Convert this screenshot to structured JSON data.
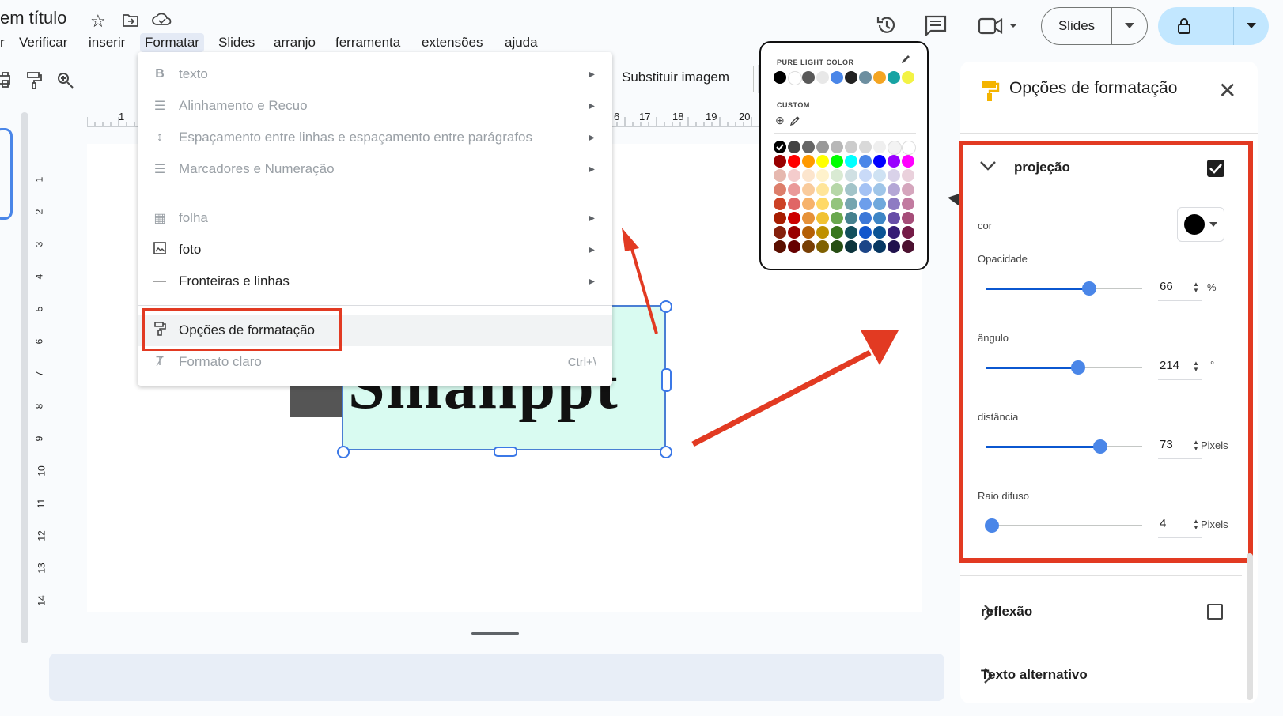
{
  "doc": {
    "title": "em título"
  },
  "menu": [
    "r",
    "Verificar",
    "inserir",
    "Formatar",
    "Slides",
    "arranjo",
    "ferramenta",
    "extensões",
    "ajuda"
  ],
  "menu_active": "Formatar",
  "header_buttons": {
    "slides": "Slides"
  },
  "toolbar": {
    "replace_image": "Substituir imagem"
  },
  "rulers": {
    "h": [
      "1",
      "6",
      "17",
      "18",
      "19",
      "20"
    ],
    "v": [
      "1",
      "2",
      "3",
      "4",
      "5",
      "6",
      "7",
      "8",
      "9",
      "10",
      "11",
      "12",
      "13",
      "14"
    ]
  },
  "slide": {
    "logo_text": "Smallppt"
  },
  "format_menu": {
    "items": [
      {
        "icon": "B",
        "label": "texto",
        "enabled": false,
        "submenu": true
      },
      {
        "icon": "align",
        "label": "Alinhamento e Recuo",
        "enabled": false,
        "submenu": true
      },
      {
        "icon": "spacing",
        "label": "Espaçamento entre linhas e espaçamento entre parágrafos",
        "enabled": false,
        "submenu": true
      },
      {
        "icon": "list",
        "label": "Marcadores e Numeração",
        "enabled": false,
        "submenu": true
      },
      {
        "icon": "table",
        "label": "folha",
        "enabled": false,
        "submenu": true
      },
      {
        "icon": "image",
        "label": "foto",
        "enabled": true,
        "submenu": true
      },
      {
        "icon": "line",
        "label": "Fronteiras e linhas",
        "enabled": true,
        "submenu": true
      },
      {
        "icon": "paint-format",
        "label": "Opções de formatação",
        "enabled": true,
        "submenu": false
      },
      {
        "icon": "clear-format",
        "label": "Formato claro",
        "enabled": false,
        "submenu": false,
        "shortcut": "Ctrl+\\"
      }
    ]
  },
  "color_picker": {
    "section1": "PURE LIGHT COLOR",
    "section2": "CUSTOM",
    "top_colors": [
      "#000000",
      "#ffffff",
      "#595959",
      "#e8e8e8",
      "#4a86e8",
      "#222222",
      "#6d8fa0",
      "#f4a522",
      "#17a3a3",
      "#f3f345"
    ],
    "grid_rows": [
      [
        "#000000",
        "#434343",
        "#666666",
        "#999999",
        "#b7b7b7",
        "#cccccc",
        "#d9d9d9",
        "#efefef",
        "#f3f3f3",
        "#ffffff"
      ],
      [
        "#980000",
        "#ff0000",
        "#ff9900",
        "#ffff00",
        "#00ff00",
        "#00ffff",
        "#4a86e8",
        "#0000ff",
        "#9900ff",
        "#ff00ff"
      ],
      [
        "#e6b8af",
        "#f4cccc",
        "#fce5cd",
        "#fff2cc",
        "#d9ead3",
        "#d0e0e3",
        "#c9daf8",
        "#cfe2f3",
        "#d9d2e9",
        "#ead1dc"
      ],
      [
        "#dd7e6b",
        "#ea9999",
        "#f9cb9c",
        "#ffe599",
        "#b6d7a8",
        "#a2c4c9",
        "#a4c2f4",
        "#9fc5e8",
        "#b4a7d6",
        "#d5a6bd"
      ],
      [
        "#cc4125",
        "#e06666",
        "#f6b26b",
        "#ffd966",
        "#93c47d",
        "#76a5af",
        "#6d9eeb",
        "#6fa8dc",
        "#8e7cc3",
        "#c27ba0"
      ],
      [
        "#a61c00",
        "#cc0000",
        "#e69138",
        "#f1c232",
        "#6aa84f",
        "#45818e",
        "#3c78d8",
        "#3d85c6",
        "#674ea7",
        "#a64d79"
      ],
      [
        "#85200c",
        "#990000",
        "#b45f06",
        "#bf9000",
        "#38761d",
        "#134f5c",
        "#1155cc",
        "#0b5394",
        "#351c75",
        "#741b47"
      ],
      [
        "#5b0f00",
        "#660000",
        "#783f04",
        "#7f6000",
        "#274e13",
        "#0c343d",
        "#1c4587",
        "#073763",
        "#20124d",
        "#4c1130"
      ]
    ]
  },
  "panel": {
    "title": "Opções de formatação",
    "shadow": {
      "label": "projeção",
      "enabled": true,
      "color_label": "cor",
      "color": "#000000",
      "opacity": {
        "label": "Opacidade",
        "value": "66",
        "unit": "%",
        "level": 0.66
      },
      "angle": {
        "label": "ângulo",
        "value": "214",
        "unit": "°",
        "level": 0.59
      },
      "distance": {
        "label": "distância",
        "value": "73",
        "unit": "Pixels",
        "level": 0.73
      },
      "blur": {
        "label": "Raio difuso",
        "value": "4",
        "unit": "Pixels",
        "level": 0.04
      }
    },
    "reflection": {
      "label": "reflexão",
      "enabled": false
    },
    "alt_text": {
      "label": "Texto alternativo"
    }
  },
  "colors": {
    "accent": "#0b57d0",
    "highlight": "#e23a22",
    "selection": "#4a7fd4"
  }
}
